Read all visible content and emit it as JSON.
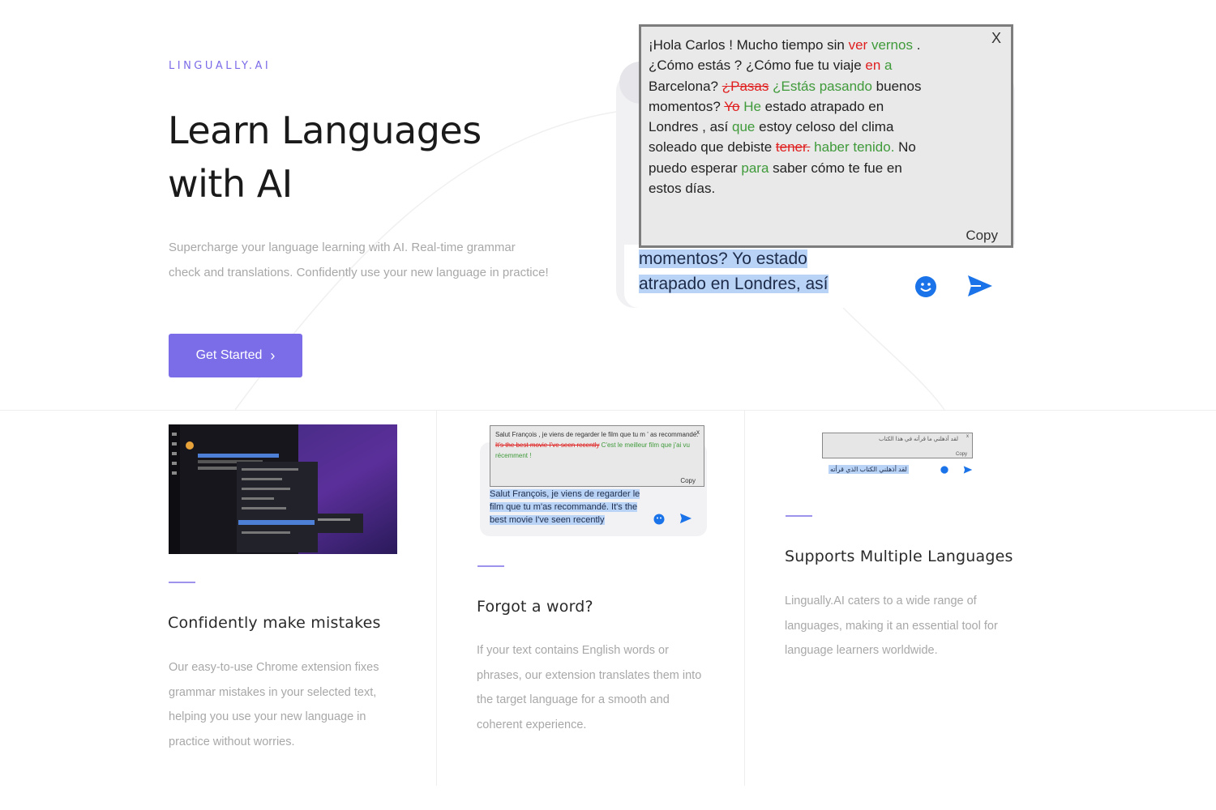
{
  "hero": {
    "brand": "LINGUALLY.AI",
    "title_line1": "Learn Languages",
    "title_line2": "with AI",
    "subtitle": "Supercharge your language learning with AI. Real-time grammar check and translations. Confidently use your new language in practice!",
    "cta_label": "Get Started"
  },
  "demo": {
    "popup_parts": [
      {
        "t": "¡Hola Carlos ! Mucho tiempo sin ",
        "c": ""
      },
      {
        "t": "ver",
        "c": "r"
      },
      {
        "t": " vernos",
        "c": "g"
      },
      {
        "t": " . ¿Cómo estás ? ¿Cómo fue tu viaje ",
        "c": ""
      },
      {
        "t": "en",
        "c": "r"
      },
      {
        "t": " a",
        "c": "g"
      },
      {
        "t": " Barcelona? ",
        "c": ""
      },
      {
        "t": "¿Pasas",
        "c": "s"
      },
      {
        "t": " ¿Estás pasando",
        "c": "g"
      },
      {
        "t": " buenos momentos? ",
        "c": ""
      },
      {
        "t": "Yo",
        "c": "s"
      },
      {
        "t": " He",
        "c": "g"
      },
      {
        "t": " estado atrapado en Londres , así ",
        "c": ""
      },
      {
        "t": "que",
        "c": "g"
      },
      {
        "t": " estoy celoso del clima soleado que debiste ",
        "c": ""
      },
      {
        "t": "tener.",
        "c": "s"
      },
      {
        "t": " haber tenido.",
        "c": "g"
      },
      {
        "t": " No puedo esperar ",
        "c": ""
      },
      {
        "t": "para",
        "c": "g"
      },
      {
        "t": " saber cómo te fue en estos días.",
        "c": ""
      }
    ],
    "close_label": "X",
    "copy_label": "Copy",
    "compose_line1": "momentos? Yo estado",
    "compose_line2": "atrapado en Londres, así"
  },
  "features": [
    {
      "title": "Confidently make mistakes",
      "desc": "Our easy-to-use Chrome extension fixes grammar mistakes in your selected text, helping you use your new language in practice without worries."
    },
    {
      "title": "Forgot a word?",
      "desc": "If your text contains English words or phrases, our extension translates them into the target language for a smooth and coherent experience."
    },
    {
      "title": "Supports Multiple Languages",
      "desc": "Lingually.AI caters to a wide range of languages, making it an essential tool for language learners worldwide."
    }
  ],
  "f2_demo": {
    "popup_parts": [
      {
        "t": "Salut François , je viens de regarder le film que tu m ' as recommandé. ",
        "c": ""
      },
      {
        "t": "It's the best movie I've seen recently",
        "c": "s"
      },
      {
        "t": " C'est le meilleur film que j'ai vu récemment !",
        "c": "g"
      }
    ],
    "close_label": "x",
    "copy_label": "Copy",
    "compose": "Salut François, je viens de regarder le film que tu m'as recommandé. It's the best movie I've seen recently"
  },
  "f3_demo": {
    "popup": "لقد أذهلني ما قرأته في هذا الكتاب",
    "close_label": "x",
    "copy_label": "Copy",
    "compose": "لقد أذهلني الكتاب الذي قرأته"
  },
  "colors": {
    "accent": "#7b6ce8",
    "correction_green": "#3f9a3a",
    "correction_red": "#e02020",
    "selection": "#b9d3f7",
    "send_blue": "#1a73e8"
  },
  "icons": [
    "chevron-right-icon",
    "close-icon",
    "emoji-icon",
    "send-icon"
  ]
}
